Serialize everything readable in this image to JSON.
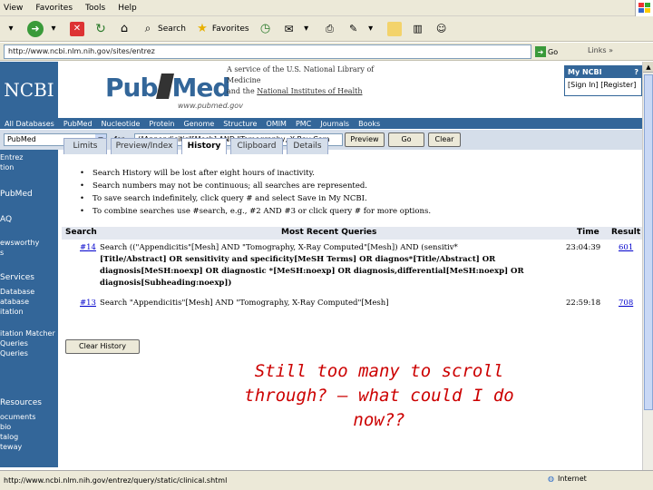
{
  "menu": {
    "view": "View",
    "favorites": "Favorites",
    "tools": "Tools",
    "help": "Help"
  },
  "toolbar": {
    "search": "Search",
    "favorites": "Favorites"
  },
  "address": {
    "url": "http://www.ncbi.nlm.nih.gov/sites/entrez",
    "go": "Go",
    "links": "Links"
  },
  "header": {
    "ncbi": "NCBI",
    "pub": "Pub",
    "med": "Med",
    "url": "www.pubmed.gov",
    "service_line1": "A service of the U.S. National Library of Medicine",
    "service_line2_prefix": "and the ",
    "service_line2_link": "National Institutes of Health",
    "myncbi": "My NCBI",
    "myncbi_help": "?",
    "sign": "[Sign In] [Register]"
  },
  "nav": [
    "All Databases",
    "PubMed",
    "Nucleotide",
    "Protein",
    "Genome",
    "Structure",
    "OMIM",
    "PMC",
    "Journals",
    "Books"
  ],
  "search": {
    "db": "PubMed",
    "for": "for",
    "query": "(\"Appendicitis\"[Mesh] AND \"Tomography, X-Ray Com",
    "preview": "Preview",
    "go": "Go",
    "clear": "Clear"
  },
  "tabs": [
    "Limits",
    "Preview/Index",
    "History",
    "Clipboard",
    "Details"
  ],
  "leftnav": [
    "Entrez",
    "tion",
    "PubMed",
    "AQ",
    "ewsworthy",
    "s",
    "Services",
    "Database",
    "atabase",
    "itation",
    "itation Matcher",
    "Queries",
    "Queries",
    "Resources",
    "ocuments",
    "bio",
    "talog",
    "teway"
  ],
  "bullets": [
    "Search History will be lost after eight hours of inactivity.",
    "Search numbers may not be continuous; all searches are represented.",
    "To save search indefinitely, click query # and select Save in My NCBI.",
    "To combine searches use #search, e.g., #2 AND #3 or click query # for more options."
  ],
  "history": {
    "headers": {
      "search": "Search",
      "queries": "Most Recent Queries",
      "time": "Time",
      "result": "Result"
    },
    "rows": [
      {
        "num": "#14",
        "query_l1": "Search ((\"Appendicitis\"[Mesh] AND \"Tomography, X-Ray Computed\"[Mesh]) AND (sensitiv*",
        "query_l2": "[Title/Abstract] OR sensitivity and specificity[MeSH Terms] OR diagnos*[Title/Abstract] OR",
        "query_l3": "diagnosis[MeSH:noexp] OR diagnostic *[MeSH:noexp] OR diagnosis,differential[MeSH:noexp] OR",
        "query_l4": "diagnosis[Subheading:noexp])",
        "time": "23:04:39",
        "result": "601"
      },
      {
        "num": "#13",
        "query_l1": "Search \"Appendicitis\"[Mesh] AND \"Tomography, X-Ray Computed\"[Mesh]",
        "time": "22:59:18",
        "result": "708"
      }
    ]
  },
  "clear_history": "Clear History",
  "annotation": "Still too many to scroll through? – what could I do now??",
  "status": {
    "url": "http://www.ncbi.nlm.nih.gov/entrez/query/static/clinical.shtml",
    "zone": "Internet"
  },
  "colors": {
    "ncbi_blue": "#336699",
    "annotation_red": "#cc0000",
    "link_blue": "#0000cc"
  }
}
